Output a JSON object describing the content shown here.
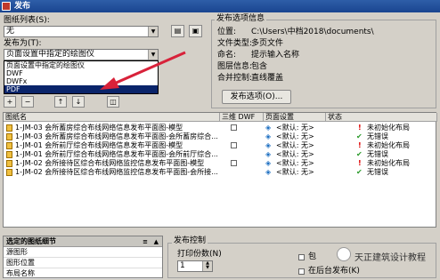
{
  "window": {
    "title": "发布"
  },
  "sheet_list": {
    "label": "图纸列表(S):",
    "value": "无"
  },
  "publish_to": {
    "label": "发布为(T):",
    "value": "页面设置中指定的绘图仪",
    "options": [
      "页面设置中指定的绘图仪",
      "DWF",
      "DWFx",
      "PDF"
    ],
    "selected_index": 3
  },
  "info": {
    "title": "发布选项信息",
    "rows": [
      {
        "label": "位置:",
        "value": "C:\\Users\\中档2018\\documents\\"
      },
      {
        "label": "文件类型:",
        "value": "多页文件"
      },
      {
        "label": "命名:",
        "value": "提示输入名称"
      },
      {
        "label": "图层信息:",
        "value": "包含"
      },
      {
        "label": "合并控制:",
        "value": "直线覆盖"
      }
    ],
    "options_button": "发布选项(O)..."
  },
  "table": {
    "headers": [
      "图纸名",
      "三维 DWF",
      "页面设置",
      "状态"
    ],
    "rows": [
      {
        "name": "1-JM-03 会所蓄房综合布线网络信息发布平面图-模型",
        "page_setup": "<默认: 无>",
        "status": "未初始化布局",
        "status_type": "warn"
      },
      {
        "name": "1-JM-03 会所蓄房综合布线网络信息发布平面图-会所蓄房综合...",
        "page_setup": "<默认: 无>",
        "status": "无错误",
        "status_type": "ok"
      },
      {
        "name": "1-JM-01 会所前厅综合布线网络信息发布平面图-模型",
        "page_setup": "<默认: 无>",
        "status": "未初始化布局",
        "status_type": "warn"
      },
      {
        "name": "1-JM-01 会所前厅综合布线网络信息发布平面图-会所前厅综合...",
        "page_setup": "<默认: 无>",
        "status": "无错误",
        "status_type": "ok"
      },
      {
        "name": "1-JM-02 会所接待区综合布线网络监控信息发布平面图-模型",
        "page_setup": "<默认: 无>",
        "status": "未初始化布局",
        "status_type": "warn"
      },
      {
        "name": "1-JM-02 会所接待区综合布线网络监控信息发布平面图-会所接...",
        "page_setup": "<默认: 无>",
        "status": "无错误",
        "status_type": "ok"
      }
    ]
  },
  "details": {
    "title": "选定的图纸细节",
    "rows": [
      "源图形",
      "图形位置",
      "布局名称"
    ]
  },
  "publish_control": {
    "title": "发布控制",
    "copies_label": "打印份数(N)",
    "copies_value": "1",
    "include_label": "包",
    "background_label": "在后台发布(K)"
  },
  "watermark": {
    "text": "天正建筑设计教程"
  },
  "colors": {
    "title_bg": "#1a4590",
    "selection": "#0a246a",
    "arrow": "#d8223a"
  }
}
